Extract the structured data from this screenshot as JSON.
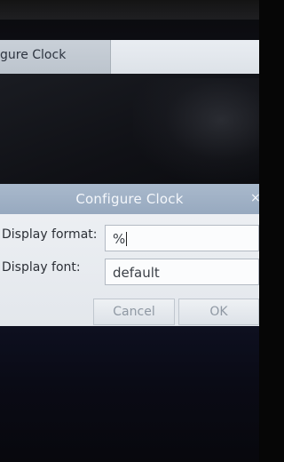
{
  "background_window": {
    "title": "gure Clock"
  },
  "dialog": {
    "title": "Configure Clock",
    "close_glyph": "×",
    "fields": [
      {
        "label": "Display format:",
        "value": "%"
      },
      {
        "label": "Display font:",
        "value": "default"
      }
    ],
    "buttons": {
      "cancel": "Cancel",
      "ok": "OK"
    }
  },
  "colors": {
    "titlebar": "#a9b9cc",
    "dialog_bg": "#e4e8ed",
    "desktop": "#101116"
  }
}
